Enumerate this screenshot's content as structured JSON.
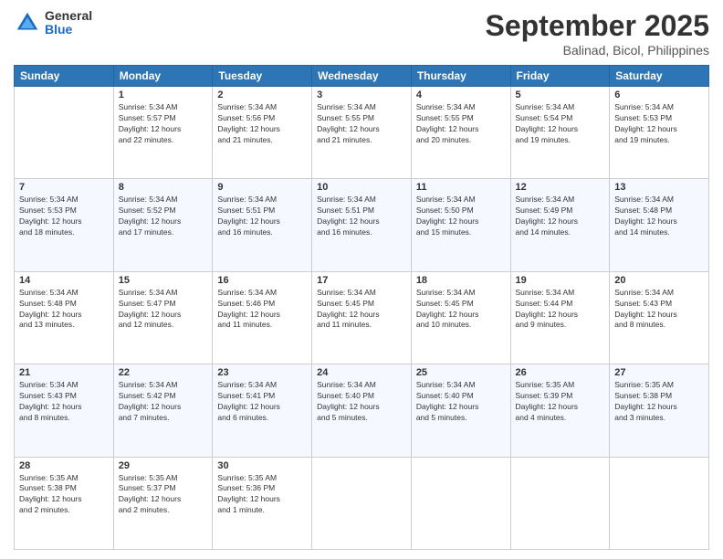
{
  "logo": {
    "general": "General",
    "blue": "Blue"
  },
  "header": {
    "month": "September 2025",
    "location": "Balinad, Bicol, Philippines"
  },
  "weekdays": [
    "Sunday",
    "Monday",
    "Tuesday",
    "Wednesday",
    "Thursday",
    "Friday",
    "Saturday"
  ],
  "weeks": [
    [
      {
        "day": "",
        "info": ""
      },
      {
        "day": "1",
        "info": "Sunrise: 5:34 AM\nSunset: 5:57 PM\nDaylight: 12 hours\nand 22 minutes."
      },
      {
        "day": "2",
        "info": "Sunrise: 5:34 AM\nSunset: 5:56 PM\nDaylight: 12 hours\nand 21 minutes."
      },
      {
        "day": "3",
        "info": "Sunrise: 5:34 AM\nSunset: 5:55 PM\nDaylight: 12 hours\nand 21 minutes."
      },
      {
        "day": "4",
        "info": "Sunrise: 5:34 AM\nSunset: 5:55 PM\nDaylight: 12 hours\nand 20 minutes."
      },
      {
        "day": "5",
        "info": "Sunrise: 5:34 AM\nSunset: 5:54 PM\nDaylight: 12 hours\nand 19 minutes."
      },
      {
        "day": "6",
        "info": "Sunrise: 5:34 AM\nSunset: 5:53 PM\nDaylight: 12 hours\nand 19 minutes."
      }
    ],
    [
      {
        "day": "7",
        "info": "Sunrise: 5:34 AM\nSunset: 5:53 PM\nDaylight: 12 hours\nand 18 minutes."
      },
      {
        "day": "8",
        "info": "Sunrise: 5:34 AM\nSunset: 5:52 PM\nDaylight: 12 hours\nand 17 minutes."
      },
      {
        "day": "9",
        "info": "Sunrise: 5:34 AM\nSunset: 5:51 PM\nDaylight: 12 hours\nand 16 minutes."
      },
      {
        "day": "10",
        "info": "Sunrise: 5:34 AM\nSunset: 5:51 PM\nDaylight: 12 hours\nand 16 minutes."
      },
      {
        "day": "11",
        "info": "Sunrise: 5:34 AM\nSunset: 5:50 PM\nDaylight: 12 hours\nand 15 minutes."
      },
      {
        "day": "12",
        "info": "Sunrise: 5:34 AM\nSunset: 5:49 PM\nDaylight: 12 hours\nand 14 minutes."
      },
      {
        "day": "13",
        "info": "Sunrise: 5:34 AM\nSunset: 5:48 PM\nDaylight: 12 hours\nand 14 minutes."
      }
    ],
    [
      {
        "day": "14",
        "info": "Sunrise: 5:34 AM\nSunset: 5:48 PM\nDaylight: 12 hours\nand 13 minutes."
      },
      {
        "day": "15",
        "info": "Sunrise: 5:34 AM\nSunset: 5:47 PM\nDaylight: 12 hours\nand 12 minutes."
      },
      {
        "day": "16",
        "info": "Sunrise: 5:34 AM\nSunset: 5:46 PM\nDaylight: 12 hours\nand 11 minutes."
      },
      {
        "day": "17",
        "info": "Sunrise: 5:34 AM\nSunset: 5:45 PM\nDaylight: 12 hours\nand 11 minutes."
      },
      {
        "day": "18",
        "info": "Sunrise: 5:34 AM\nSunset: 5:45 PM\nDaylight: 12 hours\nand 10 minutes."
      },
      {
        "day": "19",
        "info": "Sunrise: 5:34 AM\nSunset: 5:44 PM\nDaylight: 12 hours\nand 9 minutes."
      },
      {
        "day": "20",
        "info": "Sunrise: 5:34 AM\nSunset: 5:43 PM\nDaylight: 12 hours\nand 8 minutes."
      }
    ],
    [
      {
        "day": "21",
        "info": "Sunrise: 5:34 AM\nSunset: 5:43 PM\nDaylight: 12 hours\nand 8 minutes."
      },
      {
        "day": "22",
        "info": "Sunrise: 5:34 AM\nSunset: 5:42 PM\nDaylight: 12 hours\nand 7 minutes."
      },
      {
        "day": "23",
        "info": "Sunrise: 5:34 AM\nSunset: 5:41 PM\nDaylight: 12 hours\nand 6 minutes."
      },
      {
        "day": "24",
        "info": "Sunrise: 5:34 AM\nSunset: 5:40 PM\nDaylight: 12 hours\nand 5 minutes."
      },
      {
        "day": "25",
        "info": "Sunrise: 5:34 AM\nSunset: 5:40 PM\nDaylight: 12 hours\nand 5 minutes."
      },
      {
        "day": "26",
        "info": "Sunrise: 5:35 AM\nSunset: 5:39 PM\nDaylight: 12 hours\nand 4 minutes."
      },
      {
        "day": "27",
        "info": "Sunrise: 5:35 AM\nSunset: 5:38 PM\nDaylight: 12 hours\nand 3 minutes."
      }
    ],
    [
      {
        "day": "28",
        "info": "Sunrise: 5:35 AM\nSunset: 5:38 PM\nDaylight: 12 hours\nand 2 minutes."
      },
      {
        "day": "29",
        "info": "Sunrise: 5:35 AM\nSunset: 5:37 PM\nDaylight: 12 hours\nand 2 minutes."
      },
      {
        "day": "30",
        "info": "Sunrise: 5:35 AM\nSunset: 5:36 PM\nDaylight: 12 hours\nand 1 minute."
      },
      {
        "day": "",
        "info": ""
      },
      {
        "day": "",
        "info": ""
      },
      {
        "day": "",
        "info": ""
      },
      {
        "day": "",
        "info": ""
      }
    ]
  ]
}
